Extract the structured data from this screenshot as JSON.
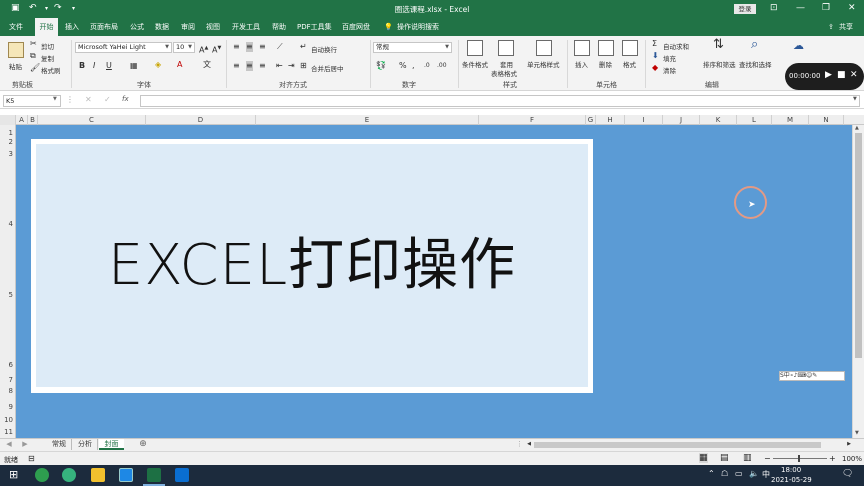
{
  "window": {
    "title": "圈选课程.xlsx - Excel",
    "login_label": "登录",
    "share_label": "共享"
  },
  "ribbon_tabs": [
    "文件",
    "开始",
    "插入",
    "页面布局",
    "公式",
    "数据",
    "审阅",
    "视图",
    "开发工具",
    "帮助",
    "PDF工具集",
    "百度网盘",
    "操作说明搜索"
  ],
  "ribbon": {
    "clipboard": {
      "paste": "粘贴",
      "cut": "剪切",
      "copy": "复制",
      "format_painter": "格式刷",
      "group": "剪贴板"
    },
    "font": {
      "name": "Microsoft YaHei Light",
      "size": "10",
      "group": "字体"
    },
    "alignment": {
      "wrap": "自动换行",
      "merge": "合并后居中",
      "group": "对齐方式"
    },
    "number": {
      "format": "常规",
      "group": "数字"
    },
    "styles": {
      "conditional": "条件格式",
      "table_fmt_1": "套用",
      "table_fmt_2": "表格格式",
      "cell_styles": "单元格样式",
      "group": "样式"
    },
    "cells": {
      "insert": "插入",
      "delete": "删除",
      "format": "格式",
      "group": "单元格"
    },
    "editing": {
      "autosum": "自动求和",
      "fill": "填充",
      "clear": "清除",
      "sort": "排序和筛选",
      "find": "查找和选择",
      "group": "编辑"
    }
  },
  "recorder": {
    "time": "00:00:00"
  },
  "formula_bar": {
    "name_box": "K5",
    "fx": "fx"
  },
  "columns": [
    "A",
    "B",
    "C",
    "D",
    "E",
    "F",
    "G",
    "H",
    "I",
    "J",
    "K",
    "L",
    "M",
    "N"
  ],
  "rows": [
    "1",
    "2",
    "3",
    "4",
    "5",
    "6",
    "7",
    "8",
    "9",
    "10",
    "11"
  ],
  "cover": {
    "title": "EXCEL打印操作"
  },
  "ime_bar": "S中∘♪⌨☺✎",
  "sheet_tabs": [
    "常规",
    "分析",
    "封面"
  ],
  "active_sheet": "封面",
  "status": {
    "ready": "就绪",
    "zoom": "100%"
  },
  "taskbar": {
    "time": "18:00",
    "date": "2021-05-29"
  },
  "colors": {
    "excel_green": "#217346",
    "sheet_bg": "#5b9bd5",
    "cover_fill": "#ddebf7"
  }
}
